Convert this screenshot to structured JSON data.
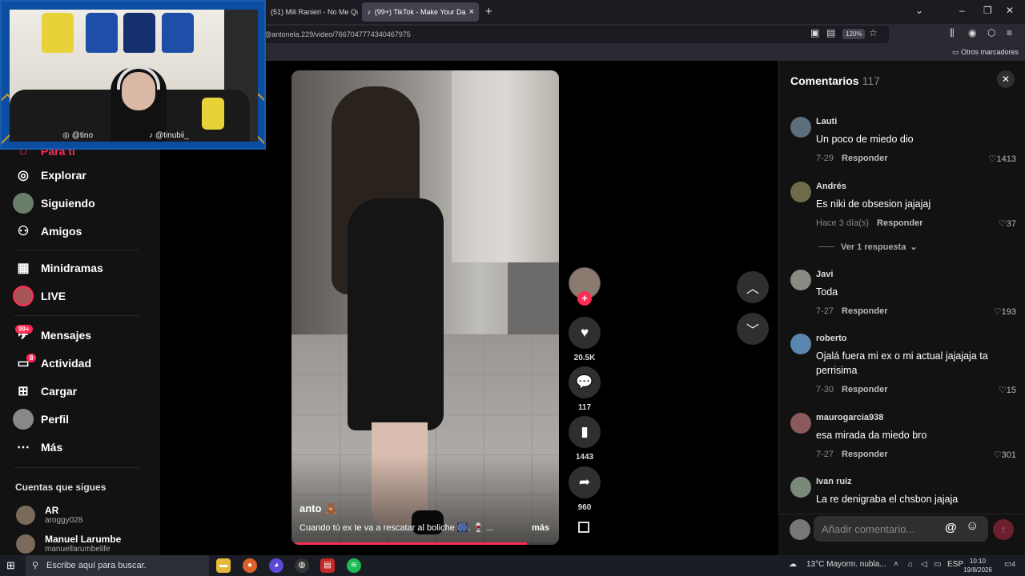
{
  "browser": {
    "tabs": [
      {
        "label": "(51) Mili Ranieri - No Me Quer"
      },
      {
        "label": "(99+) TikTok - Make Your Da"
      }
    ],
    "url": "@antonela.229/video/7667047774340467975",
    "zoom": "120%",
    "bookmarks_label": "Otros marcadores"
  },
  "webcam": {
    "handle_ig": "@tino",
    "handle_tt": "@tinubii_"
  },
  "sidebar": {
    "items": [
      {
        "label": "Para ti"
      },
      {
        "label": "Explorar"
      },
      {
        "label": "Siguiendo"
      },
      {
        "label": "Amigos"
      },
      {
        "label": "Minidramas"
      },
      {
        "label": "LIVE"
      },
      {
        "label": "Mensajes",
        "badge": "99+"
      },
      {
        "label": "Actividad",
        "badge": "8"
      },
      {
        "label": "Cargar"
      },
      {
        "label": "Perfil"
      },
      {
        "label": "Más"
      }
    ],
    "following_header": "Cuentas que sigues",
    "following": [
      {
        "name": "AR",
        "handle": "aroggy028"
      },
      {
        "name": "Manuel Larumbe",
        "handle": "manuellarumbelife"
      }
    ]
  },
  "video": {
    "author": "anto 🧸",
    "caption": "Cuando tú ex te va a rescatar al boliche 🎆. 🍷 ...",
    "more": "más",
    "progress": 0.88
  },
  "actions": {
    "likes": "20.5K",
    "comments": "117",
    "saves": "1443",
    "shares": "960"
  },
  "comments": {
    "title": "Comentarios",
    "count": "117",
    "reply_label": "Responder",
    "items": [
      {
        "user": "Lauti",
        "text": "Un poco de miedo dio",
        "date": "7-29",
        "likes": "1413"
      },
      {
        "user": "Andrés",
        "text": "Es niki de obsesion jajajaj",
        "date": "Hace 3 día(s)",
        "likes": "37"
      },
      {
        "user": "Javi",
        "text": "Toda",
        "date": "7-27",
        "likes": "193"
      },
      {
        "user": "roberto",
        "text": "Ojalá fuera mi ex o mi actual jajajaja ta perrisima",
        "date": "7-30",
        "likes": "15"
      },
      {
        "user": "maurogarcia938",
        "text": "esa mirada da miedo bro",
        "date": "7-27",
        "likes": "301"
      },
      {
        "user": "Ivan ruiz",
        "text": "La re denigraba el chsbon jajaja",
        "date": "",
        "likes": ""
      }
    ],
    "view_replies": "Ver 1 respuesta",
    "input_placeholder": "Añadir comentario..."
  },
  "taskbar": {
    "search_placeholder": "Escribe aquí para buscar.",
    "weather": "13°C  Mayorm. nubla...",
    "lang": "ESP",
    "time": "10:10",
    "date": "19/8/2026",
    "notif": "4"
  }
}
